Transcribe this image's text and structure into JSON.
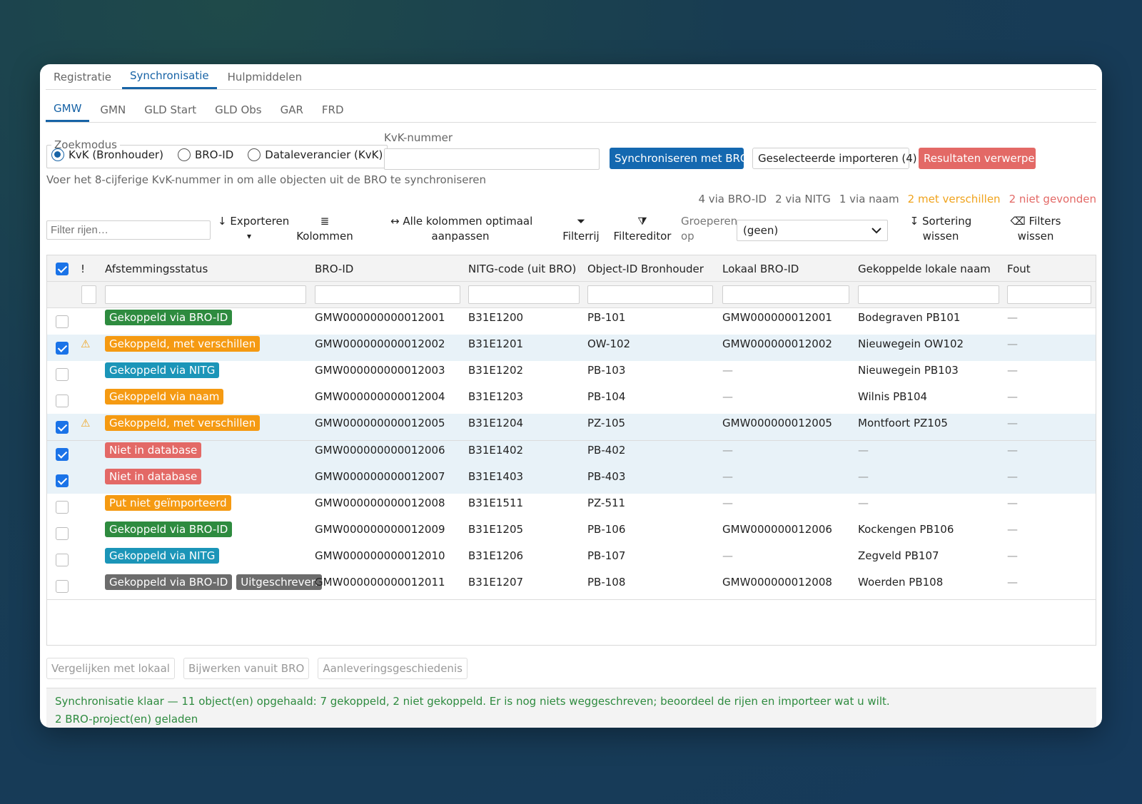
{
  "main_tabs": [
    "Registratie",
    "Synchronisatie",
    "Hulpmiddelen"
  ],
  "sub_tabs": [
    "GMW",
    "GMN",
    "GLD Start",
    "GLD Obs",
    "GAR",
    "FRD"
  ],
  "search": {
    "legend": "Zoekmodus",
    "modes": [
      "KvK (Bronhouder)",
      "BRO-ID",
      "Dataleverancier (KvK)"
    ],
    "selected": "KvK (Bronhouder)",
    "kvk_label": "KvK-nummer",
    "kvk_value": "",
    "hint": "Voer het 8-cijferige KvK-nummer in om alle objecten uit de BRO te synchroniseren"
  },
  "actions": {
    "sync": "Synchroniseren met BRO",
    "import": "Geselecteerde importeren (4)",
    "reject": "Resultaten verwerpen"
  },
  "stats": {
    "bro_id": "4 via BRO-ID",
    "nitg": "2 via NITG",
    "naam": "1 via naam",
    "verschillen": "2 met verschillen",
    "niet_gevonden": "2 niet gevonden"
  },
  "toolbar": {
    "filter_placeholder": "Filter rijen…",
    "export": "↓ Exporteren",
    "export_caret": "▾",
    "columns_icon": "≣",
    "columns": "Kolommen",
    "autosize_1": "↔ Alle kolommen optimaal",
    "autosize_2": "aanpassen",
    "filterrow_icon": "⏷",
    "filterrow": "Filterrij",
    "filtereditor_icon": "⧩",
    "filtereditor": "Filtereditor",
    "group_1": "Groeperen",
    "group_2": "op",
    "group_value": "(geen)",
    "sort_1": "↧ Sortering",
    "sort_2": "wissen",
    "filters_1": "⌫ Filters",
    "filters_2": "wissen"
  },
  "columns": [
    "!",
    "Afstemmingsstatus",
    "BRO-ID",
    "NITG-code (uit BRO)",
    "Object-ID Bronhouder",
    "Lokaal BRO-ID",
    "Gekoppelde lokale naam",
    "Fout"
  ],
  "colors": {
    "green": "#2e8b3f",
    "teal": "#1b95b8",
    "orange": "#f59a12",
    "red": "#e36966",
    "gray": "#6c6c6c"
  },
  "rows": [
    {
      "checked": false,
      "warn": "",
      "badges": [
        {
          "text": "Gekoppeld via BRO-ID",
          "color": "#2e8b3f"
        }
      ],
      "bro_id": "GMW000000000012001",
      "nitg": "B31E1200",
      "object_id": "PB-101",
      "lokaal": "GMW000000012001",
      "naam": "Bodegraven PB101",
      "fout": "—"
    },
    {
      "checked": true,
      "warn": "⚠",
      "badges": [
        {
          "text": "Gekoppeld, met verschillen",
          "color": "#f59a12"
        }
      ],
      "bro_id": "GMW000000000012002",
      "nitg": "B31E1201",
      "object_id": "OW-102",
      "lokaal": "GMW000000012002",
      "naam": "Nieuwegein OW102",
      "fout": "—"
    },
    {
      "checked": false,
      "warn": "",
      "badges": [
        {
          "text": "Gekoppeld via NITG",
          "color": "#1b95b8"
        }
      ],
      "bro_id": "GMW000000000012003",
      "nitg": "B31E1202",
      "object_id": "PB-103",
      "lokaal": "—",
      "naam": "Nieuwegein PB103",
      "fout": "—"
    },
    {
      "checked": false,
      "warn": "",
      "badges": [
        {
          "text": "Gekoppeld via naam",
          "color": "#f59a12"
        }
      ],
      "bro_id": "GMW000000000012004",
      "nitg": "B31E1203",
      "object_id": "PB-104",
      "lokaal": "—",
      "naam": "Wilnis PB104",
      "fout": "—"
    },
    {
      "checked": true,
      "warn": "⚠",
      "badges": [
        {
          "text": "Gekoppeld, met verschillen",
          "color": "#f59a12"
        }
      ],
      "bro_id": "GMW000000000012005",
      "nitg": "B31E1204",
      "object_id": "PZ-105",
      "lokaal": "GMW000000012005",
      "naam": "Montfoort PZ105",
      "fout": "—"
    },
    {
      "checked": true,
      "warn": "",
      "badges": [
        {
          "text": "Niet in database",
          "color": "#e36966"
        }
      ],
      "bro_id": "GMW000000000012006",
      "nitg": "B31E1402",
      "object_id": "PB-402",
      "lokaal": "—",
      "naam": "—",
      "fout": "—"
    },
    {
      "checked": true,
      "warn": "",
      "badges": [
        {
          "text": "Niet in database",
          "color": "#e36966"
        }
      ],
      "bro_id": "GMW000000000012007",
      "nitg": "B31E1403",
      "object_id": "PB-403",
      "lokaal": "—",
      "naam": "—",
      "fout": "—"
    },
    {
      "checked": false,
      "warn": "",
      "badges": [
        {
          "text": "Put niet geïmporteerd",
          "color": "#f59a12"
        }
      ],
      "bro_id": "GMW000000000012008",
      "nitg": "B31E1511",
      "object_id": "PZ-511",
      "lokaal": "—",
      "naam": "—",
      "fout": "—"
    },
    {
      "checked": false,
      "warn": "",
      "badges": [
        {
          "text": "Gekoppeld via BRO-ID",
          "color": "#2e8b3f"
        }
      ],
      "bro_id": "GMW000000000012009",
      "nitg": "B31E1205",
      "object_id": "PB-106",
      "lokaal": "GMW000000012006",
      "naam": "Kockengen PB106",
      "fout": "—"
    },
    {
      "checked": false,
      "warn": "",
      "badges": [
        {
          "text": "Gekoppeld via NITG",
          "color": "#1b95b8"
        }
      ],
      "bro_id": "GMW000000000012010",
      "nitg": "B31E1206",
      "object_id": "PB-107",
      "lokaal": "—",
      "naam": "Zegveld PB107",
      "fout": "—"
    },
    {
      "checked": false,
      "warn": "",
      "badges": [
        {
          "text": "Gekoppeld via BRO-ID",
          "color": "#6c6c6c"
        },
        {
          "text": "Uitgeschreven",
          "color": "#6c6c6c"
        }
      ],
      "bro_id": "GMW000000000012011",
      "nitg": "B31E1207",
      "object_id": "PB-108",
      "lokaal": "GMW000000012008",
      "naam": "Woerden PB108",
      "fout": "—"
    }
  ],
  "bottom_buttons": [
    "Vergelijken met lokaal",
    "Bijwerken vanuit BRO",
    "Aanleveringsgeschiedenis"
  ],
  "status": {
    "line1": "Synchronisatie klaar — 11 object(en) opgehaald: 7 gekoppeld, 2 niet gekoppeld. Er is nog niets weggeschreven; beoordeel de rijen en importeer wat u wilt.",
    "line2": "2 BRO-project(en) geladen"
  }
}
